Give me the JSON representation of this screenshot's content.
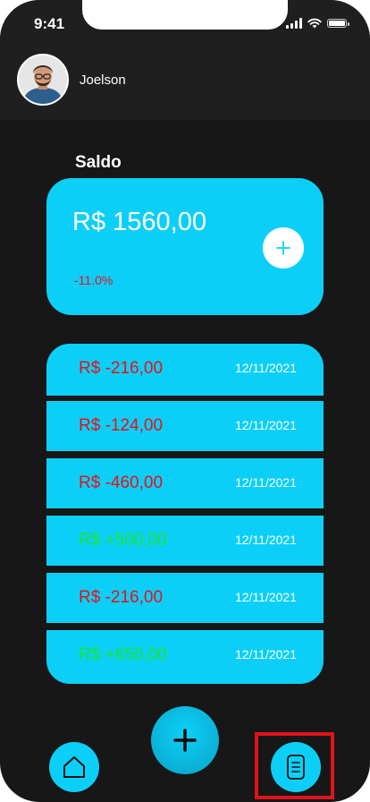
{
  "status_bar": {
    "time": "9:41"
  },
  "profile": {
    "name": "Joelson"
  },
  "balance": {
    "title": "Saldo",
    "amount": "R$ 1560,00",
    "change": "-11.0%",
    "add_icon": "plus-icon"
  },
  "transactions": [
    {
      "amount": "R$ -216,00",
      "date": "12/11/2021",
      "type": "debit"
    },
    {
      "amount": "R$ -124,00",
      "date": "12/11/2021",
      "type": "debit"
    },
    {
      "amount": "R$ -460,00",
      "date": "12/11/2021",
      "type": "debit"
    },
    {
      "amount": "R$ +500,00",
      "date": "12/11/2021",
      "type": "credit"
    },
    {
      "amount": "R$ -216,00",
      "date": "12/11/2021",
      "type": "debit"
    },
    {
      "amount": "R$ +650,00",
      "date": "12/11/2021",
      "type": "credit"
    }
  ],
  "colors": {
    "accent": "#0ccff7",
    "background": "#171717",
    "debit": "#e8101b",
    "credit": "#19e62d",
    "highlight": "#e0131b"
  },
  "nav": {
    "home_icon": "home-icon",
    "add_icon": "plus-icon",
    "document_icon": "document-icon"
  }
}
